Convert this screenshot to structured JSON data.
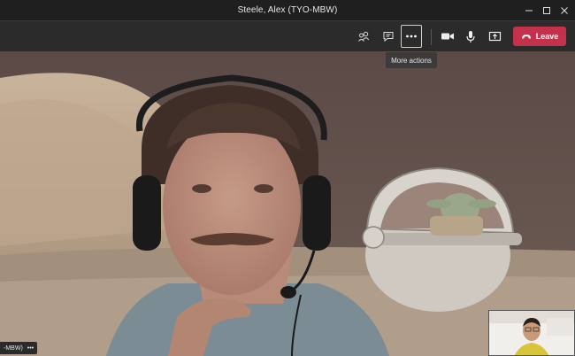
{
  "window": {
    "title": "Steele, Alex (TYO-MBW)"
  },
  "toolbar": {
    "icons": [
      "participants-icon",
      "chat-icon",
      "more-actions-icon",
      "camera-icon",
      "microphone-icon",
      "share-icon"
    ],
    "leave_label": "Leave",
    "tooltip": "More actions",
    "colors": {
      "leave": "#c4314b",
      "toolbar_bg": "#2b2b2b",
      "titlebar_bg": "#1f1f1f"
    }
  },
  "participant": {
    "name_label": "-MBW)",
    "more_glyph": "•••"
  }
}
